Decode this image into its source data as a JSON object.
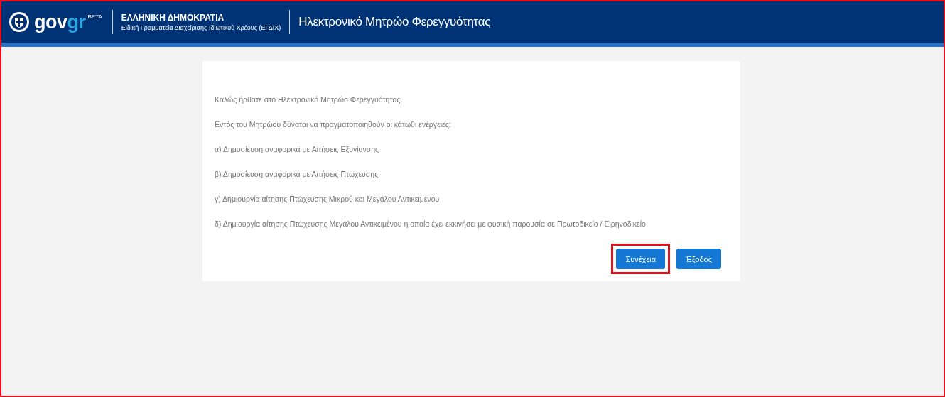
{
  "header": {
    "logo_text": "gov",
    "logo_accent": "gr",
    "logo_badge": "BETA",
    "org_title": "ΕΛΛΗΝΙΚΗ ΔΗΜΟΚΡΑΤΙΑ",
    "org_subtitle": "Ειδική Γραμματεία Διαχείρισης Ιδιωτικού Χρέους (ΕΓΔΙΧ)",
    "app_title": "Ηλεκτρονικό Μητρώο Φερεγγυότητας"
  },
  "card": {
    "paragraphs": [
      "Καλώς ήρθατε στο Ηλεκτρονικό Μητρώο Φερεγγυότητας.",
      "Εντός του Μητρώου δύναται να πραγματοποιηθούν οι κάτωθι ενέργειες:",
      "α) Δημοσίευση αναφορικά με Αιτήσεις Εξυγίανσης",
      "β) Δημοσίευση αναφορικά με Αιτήσεις Πτώχευσης",
      "γ) Δημιουργία αίτησης Πτώχευσης Μικρού και Μεγάλου Αντικειμένου",
      "δ) Δημιουργία αίτησης Πτώχευσης Μεγάλου Αντικειμένου η οποία έχει εκκινήσει με φυσική παρουσία σε Πρωτοδικείο / Ειρηνοδικείο"
    ],
    "buttons": [
      {
        "label": "Συνέχεια",
        "highlighted": true
      },
      {
        "label": "Έξοδος",
        "highlighted": false
      }
    ]
  }
}
